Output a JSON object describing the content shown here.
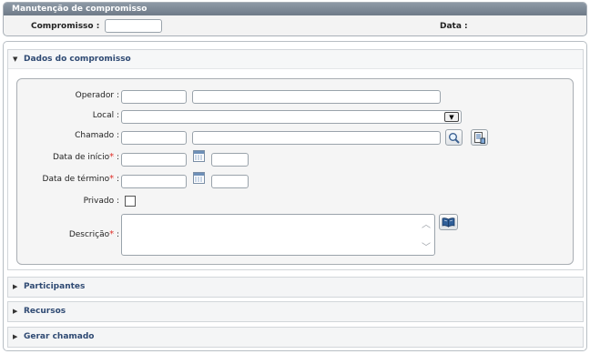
{
  "header": {
    "title": "Manutenção de compromisso",
    "compromisso_label": "Compromisso :",
    "compromisso_value": "",
    "data_label": "Data :"
  },
  "sections": {
    "dados": {
      "label": "Dados do compromisso",
      "expanded": true
    },
    "participantes": {
      "label": "Participantes",
      "expanded": false
    },
    "recursos": {
      "label": "Recursos",
      "expanded": false
    },
    "gerar_chamado": {
      "label": "Gerar chamado",
      "expanded": false
    }
  },
  "form": {
    "operador_label": "Operador :",
    "local_label": "Local :",
    "chamado_label": "Chamado :",
    "data_inicio_label": "Data de início",
    "data_termino_label": "Data de término",
    "privado_label": "Privado :",
    "descricao_label": "Descrição",
    "required_mark": "*",
    "colon": " :",
    "operador_code": "",
    "operador_name": "",
    "local_value": "",
    "chamado_code": "",
    "chamado_desc": "",
    "data_inicio_date": "",
    "data_inicio_time": "",
    "data_termino_date": "",
    "data_termino_time": "",
    "privado_checked": false,
    "descricao_value": ""
  },
  "icons": {
    "collapse_arrow": "▼",
    "expand_arrow": "▶",
    "dropdown": "▼",
    "scroll_up": "︿",
    "scroll_down": "﹀",
    "search": "search-icon",
    "detail": "document-icon",
    "calendar": "calendar-icon",
    "book": "book-icon"
  }
}
